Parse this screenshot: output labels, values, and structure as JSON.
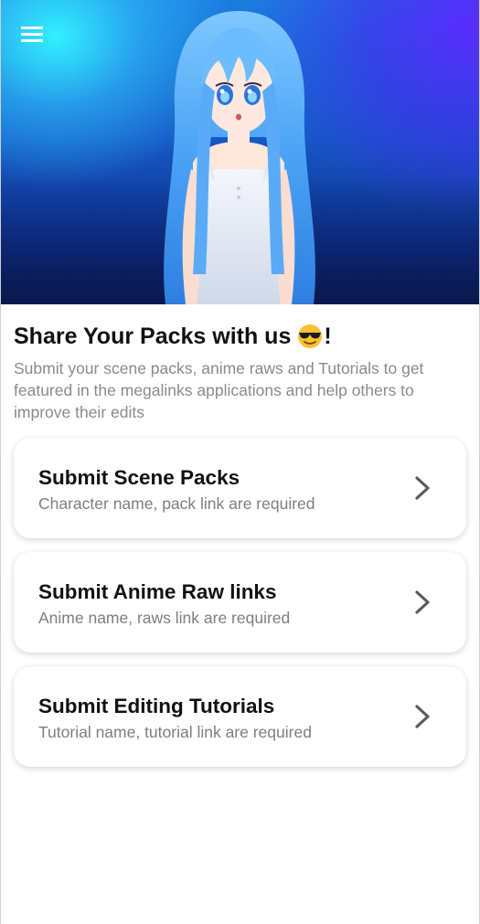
{
  "header": {
    "menu_icon": "menu-icon",
    "banner": "anime-girl-illustration"
  },
  "main": {
    "title": "Share Your Packs with us",
    "title_suffix": "!",
    "title_emoji": "sunglasses-emoji",
    "subtitle": "Submit your scene packs, anime raws and Tutorials to get featured in the megalinks applications and help others to improve their edits"
  },
  "cards": [
    {
      "title": "Submit Scene Packs",
      "subtitle": "Character name, pack link are required",
      "icon": "chevron-right-icon"
    },
    {
      "title": "Submit Anime Raw links",
      "subtitle": "Anime name, raws link are required",
      "icon": "chevron-right-icon"
    },
    {
      "title": "Submit Editing Tutorials",
      "subtitle": "Tutorial name, tutorial link are required",
      "icon": "chevron-right-icon"
    }
  ],
  "colors": {
    "hero_cyan": "#32f0ff",
    "hero_violet": "#5a2cff",
    "hero_blue": "#1659c7",
    "text_primary": "#111111",
    "text_secondary": "#8a8a8a"
  }
}
